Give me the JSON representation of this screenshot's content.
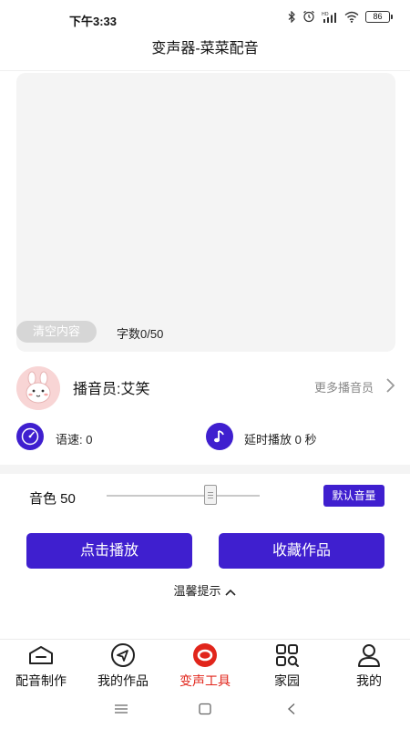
{
  "status_bar": {
    "time": "下午3:33",
    "battery": "86",
    "network_label": "HD"
  },
  "header": {
    "title": "变声器-菜菜配音"
  },
  "editor": {
    "clear_label": "清空内容",
    "char_count": "字数0/50"
  },
  "narrator": {
    "label": "播音员:艾笑",
    "more_label": "更多播音员"
  },
  "options": {
    "speed_label": "语速: 0",
    "delay_label": "延时播放 0 秒"
  },
  "tone": {
    "label": "音色 50",
    "value": 50,
    "default_volume_label": "默认音量"
  },
  "actions": {
    "play_label": "点击播放",
    "save_label": "收藏作品"
  },
  "tips": {
    "label": "温馨提示"
  },
  "tabs": [
    {
      "label": "配音制作",
      "icon": "dubbing-icon"
    },
    {
      "label": "我的作品",
      "icon": "send-icon"
    },
    {
      "label": "变声工具",
      "icon": "voice-changer-icon",
      "active": true
    },
    {
      "label": "家园",
      "icon": "grid-icon"
    },
    {
      "label": "我的",
      "icon": "user-icon"
    }
  ],
  "colors": {
    "accent": "#3f1fcf",
    "active_tab": "#e1251b",
    "panel_bg": "#f4f4f4"
  }
}
